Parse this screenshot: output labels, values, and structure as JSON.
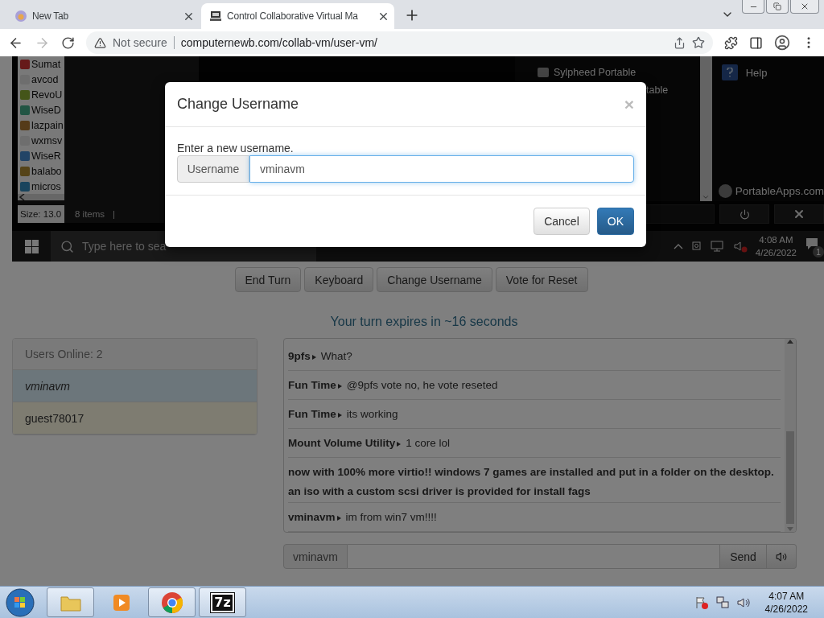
{
  "browser": {
    "tabs": [
      {
        "title": "New Tab",
        "kind": "newtab",
        "selected": false
      },
      {
        "title": "Control Collaborative Virtual Ma",
        "kind": "site",
        "selected": true
      }
    ],
    "security": "Not secure",
    "url": "computernewb.com/collab-vm/user-vm/"
  },
  "vm": {
    "explorer": {
      "files": [
        "Sumat",
        "avcod",
        "RevoU",
        "WiseD",
        "lazpain",
        "wxmsv",
        "WiseR",
        "balabo",
        "micros"
      ],
      "size": "Size: 13.0",
      "items": "8 items",
      "separator": "|"
    },
    "portable_apps": {
      "apps": [
        {
          "label": "Sylpheed Portable",
          "kind": "full"
        },
        {
          "label": "table",
          "kind": "fragment"
        }
      ],
      "help": "Help",
      "brand": "PortableApps.com"
    },
    "taskbar": {
      "search_placeholder": "Type here to sea",
      "time": "4:08 AM",
      "date": "4/26/2022",
      "notifications": "1"
    }
  },
  "controls": [
    "End Turn",
    "Keyboard",
    "Change Username",
    "Vote for Reset"
  ],
  "turn_notice": "Your turn expires in ~16 seconds",
  "users": {
    "header": "Users Online: 2",
    "list": [
      {
        "name": "vminavm",
        "kind": "self"
      },
      {
        "name": "guest78017",
        "kind": "guest"
      }
    ]
  },
  "chat": {
    "messages": [
      {
        "kind": "chat",
        "user": "9pfs",
        "text": "What?"
      },
      {
        "kind": "chat",
        "user": "Fun Time",
        "text": "@9pfs vote no, he vote reseted"
      },
      {
        "kind": "chat",
        "user": "Fun Time",
        "text": "its working"
      },
      {
        "kind": "chat",
        "user": "Mount Volume Utility",
        "text": "1 core lol"
      },
      {
        "kind": "notice",
        "text": "now with 100% more virtio!! windows 7 games are installed and put in a folder on the desktop. an iso with a custom scsi driver is provided for install fags"
      },
      {
        "kind": "chat",
        "user": "vminavm",
        "text": "im from win7 vm!!!!"
      }
    ],
    "input": {
      "username": "vminavm",
      "send": "Send"
    }
  },
  "dialog": {
    "title": "Change Username",
    "close": "×",
    "prompt": "Enter a new username.",
    "addon": "Username",
    "value": "vminavm",
    "buttons": [
      {
        "label": "Cancel",
        "kind": "default"
      },
      {
        "label": "OK",
        "kind": "primary"
      }
    ]
  },
  "taskbar": {
    "apps": [
      {
        "kind": "explorer",
        "running": true
      },
      {
        "kind": "media",
        "running": false
      },
      {
        "kind": "chrome",
        "running": true
      },
      {
        "kind": "archiver",
        "label": "7z",
        "running": true
      }
    ],
    "time": "4:07 AM",
    "date": "4/26/2022"
  }
}
